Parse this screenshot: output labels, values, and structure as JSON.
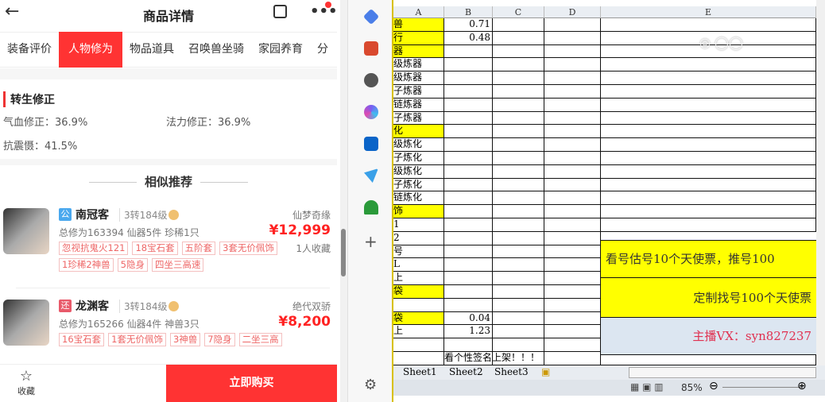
{
  "phone": {
    "title": "商品详情",
    "tabs": [
      "装备评价",
      "人物修为",
      "物品道具",
      "召唤兽坐骑",
      "家园养育",
      "分"
    ],
    "active_tab": 1,
    "section": "转生修正",
    "stats": {
      "hp": "气血修正：36.9%",
      "mp": "法力修正：36.9%",
      "shock": "抗震慑：41.5%"
    },
    "similar": "相似推荐",
    "items": [
      {
        "badge": "公",
        "badge_color": "#4aa8ee",
        "name": "南冠客",
        "level": "3转184级",
        "info": "总修为163394  仙器5件  珍稀1只",
        "server": "仙梦奇缘",
        "price": "¥12,999",
        "fav": "1人收藏",
        "tags": [
          "忽视抗鬼火121",
          "18宝石套",
          "五阶套",
          "3套无价佩饰",
          "1珍稀2神兽",
          "5隐身",
          "四坐三高速"
        ]
      },
      {
        "badge": "还",
        "badge_color": "#e85a6a",
        "name": "龙渊客",
        "level": "3转184级",
        "info": "总修为165266  仙器4件  神兽3只",
        "server": "绝代双骄",
        "price": "¥8,200",
        "fav": "",
        "tags": [
          "16宝石套",
          "1套无价佩饰",
          "3神兽",
          "7隐身",
          "二坐三高"
        ]
      }
    ],
    "fav_label": "收藏",
    "buy_label": "立即购买"
  },
  "excel": {
    "columns": [
      "A",
      "B",
      "C",
      "D",
      "E"
    ],
    "rows": [
      {
        "a": "兽",
        "b": "0.71",
        "y": 1
      },
      {
        "a": "行",
        "b": "0.48",
        "y": 1
      },
      {
        "a": "器",
        "b": "",
        "y": 1
      },
      {
        "a": "级炼器",
        "b": ""
      },
      {
        "a": "级炼器",
        "b": ""
      },
      {
        "a": "子炼器",
        "b": ""
      },
      {
        "a": "链炼器",
        "b": ""
      },
      {
        "a": "子炼器",
        "b": ""
      },
      {
        "a": "化",
        "b": "",
        "y": 1
      },
      {
        "a": "级炼化",
        "b": ""
      },
      {
        "a": "子炼化",
        "b": ""
      },
      {
        "a": "级炼化",
        "b": ""
      },
      {
        "a": "子炼化",
        "b": ""
      },
      {
        "a": "链炼化",
        "b": ""
      },
      {
        "a": "饰",
        "b": "",
        "y": 1
      },
      {
        "a": "1",
        "b": ""
      },
      {
        "a": "2",
        "b": ""
      },
      {
        "a": "号",
        "b": ""
      },
      {
        "a": "L",
        "b": ""
      },
      {
        "a": "上",
        "b": ""
      },
      {
        "a": "袋",
        "b": "",
        "y": 1
      },
      {
        "a": "",
        "b": ""
      },
      {
        "a": "袋",
        "b": "0.04",
        "y": 1
      },
      {
        "a": "上",
        "b": "1.23"
      },
      {
        "a": "",
        "b": ""
      },
      {
        "a": "",
        "b": "看个性签名上架！！！"
      }
    ],
    "merged": [
      "看号估号10个天使票，推号100",
      "定制找号100个天使票",
      "主播VX：syn827237"
    ],
    "sheets": [
      "Sheet1",
      "Sheet2",
      "Sheet3"
    ],
    "zoom": "85%"
  },
  "watermark": "◎ 快手"
}
